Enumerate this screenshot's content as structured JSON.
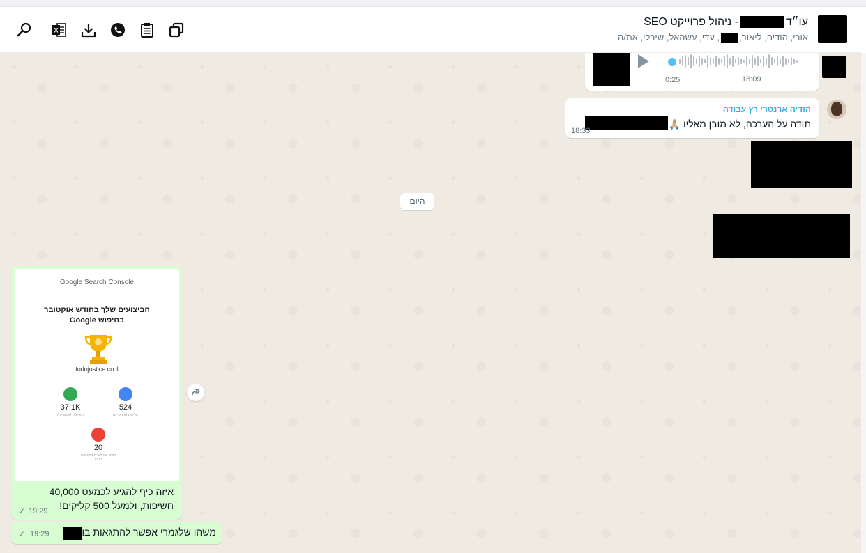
{
  "header": {
    "title_prefix": "עו״ד",
    "title_suffix": "- ניהול פרוייקט SEO",
    "subtitle_prefix": "אורי, הודיה, ליאור,",
    "subtitle_suffix": ", עדי, עשהאל, שירלי, את/ה",
    "icons": [
      "search-icon",
      "excel-icon",
      "download-icon",
      "whatsapp-icon",
      "clipboard-icon",
      "copy-icon"
    ]
  },
  "voice_message": {
    "duration": "0:25",
    "time": "18:09"
  },
  "hodia_message": {
    "sender": "הודיה ארנטרי רץ עבודה",
    "text": "תודה על הערכה, לא מובן מאליו 🙏🏼",
    "time": "18:33"
  },
  "date_chip": "היום",
  "image_message": {
    "card": {
      "logo": "Google Search Console",
      "title_line1": "הביצועים שלך בחודש אוקטובר",
      "title_line2": "בחיפוש Google",
      "domain": "todojustice.co.il",
      "metric1_value": "37.1K",
      "metric1_label": "חשיפות (אורגניות)",
      "metric2_value": "524",
      "metric2_label": "קליקים (אורגניים)",
      "metric3_value": "20",
      "metric3_label": "דפים עם חוויית משתמש טובה"
    },
    "caption_line1": "איזה כיף להגיע לכמעט 40,000",
    "caption_line2": "חשיפות, ולמעל 500 קליקים!",
    "time": "19:29"
  },
  "last_message": {
    "text": "משהו שלגמרי אפשר להתגאות בו",
    "time": "19:29"
  },
  "colors": {
    "chat_bg": "#efeae2",
    "outgoing_bubble": "#d9fdd3",
    "sender_name": "#35b3d6"
  }
}
